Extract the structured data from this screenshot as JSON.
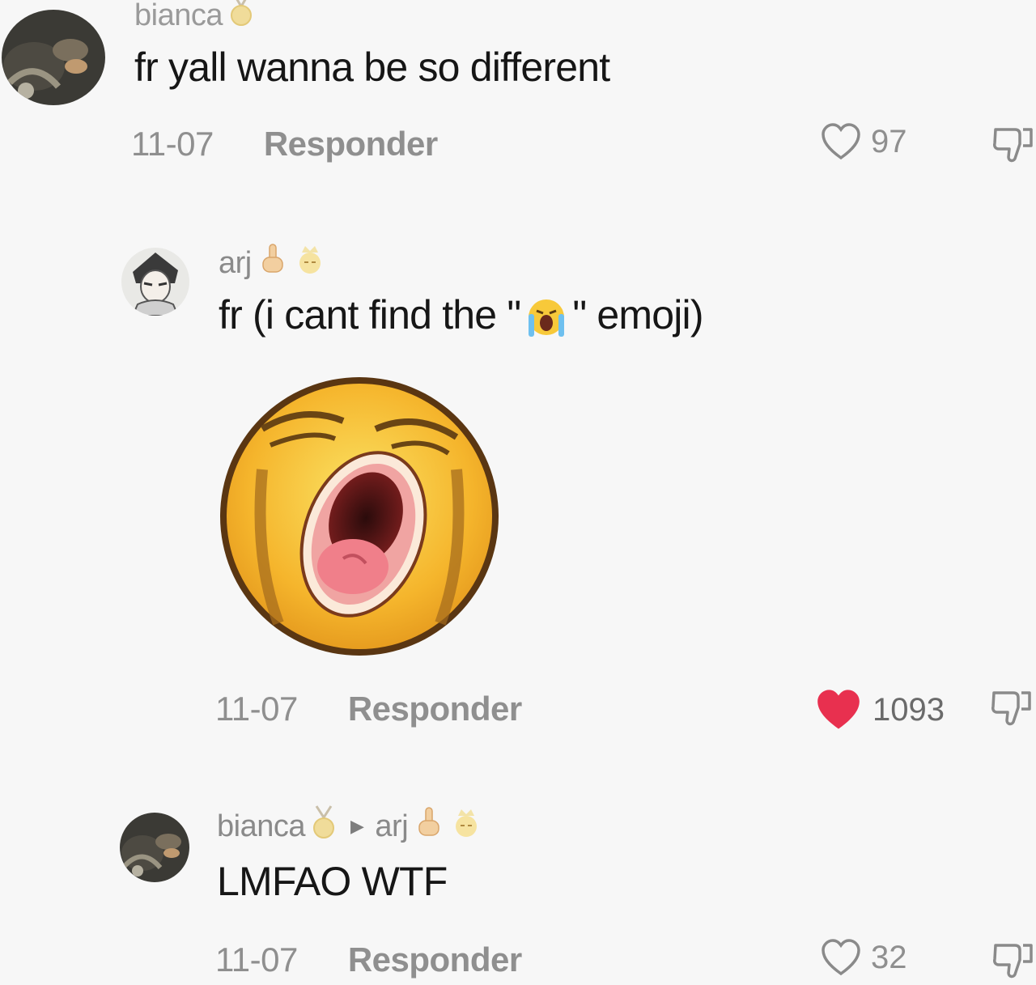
{
  "comments": [
    {
      "username": "bianca",
      "text": "fr yall wanna be so different",
      "date": "11-07",
      "reply_label": "Responder",
      "likes": "97",
      "liked": false
    },
    {
      "username": "arj",
      "text_before": "fr (i cant find the \"",
      "text_after": "\" emoji)",
      "inline_emoji": "loudly-crying-face",
      "date": "11-07",
      "reply_label": "Responder",
      "likes": "1093",
      "liked": true,
      "attached_image": "crying-face-sticker"
    },
    {
      "username": "bianca",
      "reply_to": "arj",
      "text": "LMFAO WTF",
      "date": "11-07",
      "reply_label": "Responder",
      "likes": "32",
      "liked": false
    }
  ],
  "colors": {
    "background": "#f7f7f7",
    "text": "#161616",
    "muted": "#8f8f8f",
    "like_active": "#e8304f"
  }
}
